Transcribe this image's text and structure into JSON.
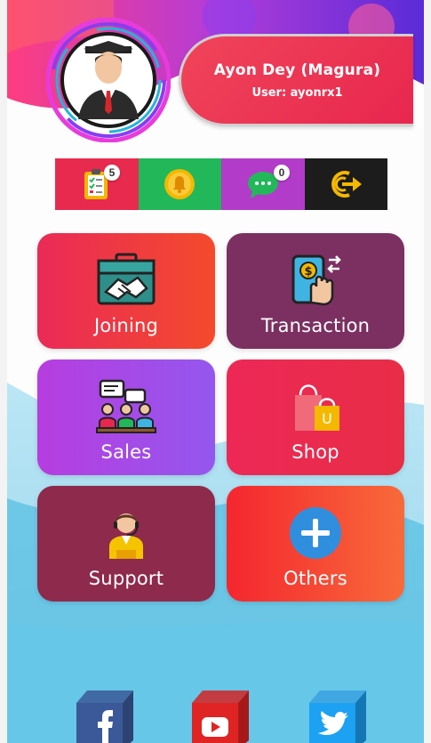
{
  "profile": {
    "name": "Ayon Dey (Magura)",
    "user": "User: ayonrx1"
  },
  "quick_actions": [
    {
      "name": "tasks",
      "badge": "5"
    },
    {
      "name": "notifications"
    },
    {
      "name": "messages",
      "badge": "0"
    },
    {
      "name": "logout"
    }
  ],
  "tiles": {
    "joining": "Joining",
    "transaction": "Transaction",
    "sales": "Sales",
    "shop": "Shop",
    "support": "Support",
    "others": "Others"
  },
  "social": [
    "facebook",
    "youtube",
    "twitter"
  ],
  "icons": {
    "tasks": "clipboard-checklist-icon",
    "notifications": "bell-icon",
    "messages": "chat-bubble-icon",
    "logout": "logout-icon",
    "joining": "handshake-briefcase-icon",
    "transaction": "phone-payment-icon",
    "sales": "meeting-icon",
    "shop": "shopping-bag-icon",
    "support": "support-agent-icon",
    "others": "plus-circle-icon"
  },
  "colors": {
    "red": "#e82a4e",
    "green": "#22b85a",
    "purple": "#b23cc9",
    "dark": "#1c1c1c",
    "plum": "#7c3061",
    "sky": "#6cc6e6",
    "gold": "#f5b800"
  }
}
